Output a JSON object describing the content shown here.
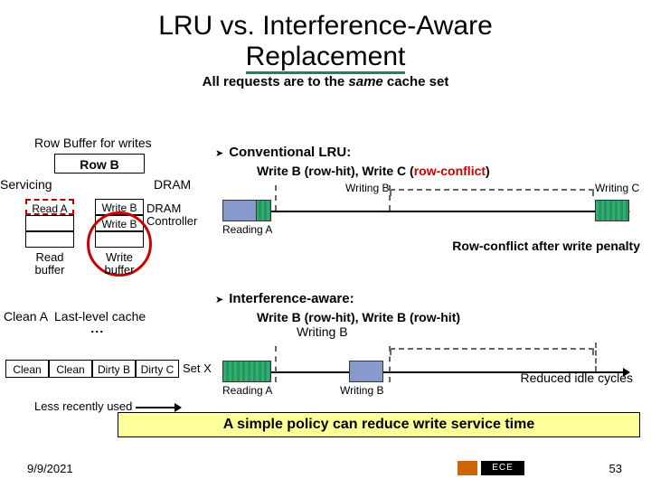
{
  "title_line1": "LRU vs. Interference-Aware",
  "title_line2": "Replacement",
  "subheader_pre": "All requests are to the ",
  "subheader_em": "same",
  "subheader_post": " cache set",
  "left": {
    "row_buffer": "Row Buffer for writes",
    "row_b": "Row B",
    "servicing": "Servicing",
    "dram": "DRAM",
    "read_a": "Read A",
    "write_b1": "Write B",
    "write_b2": "Write B",
    "dram_ctrl1": "DRAM",
    "dram_ctrl2": "Controller",
    "read_buf": "Read\nbuffer",
    "write_buf": "Write\nbuffer",
    "clean_a": "Clean A",
    "llc": "Last-level cache",
    "cells": [
      "Clean",
      "Clean",
      "Dirty B",
      "Dirty C"
    ],
    "setx": "Set X",
    "lru": "Less recently used"
  },
  "lru_section": {
    "heading": "Conventional LRU:",
    "sub": "Write B (row-hit), Write C (row-conflict)",
    "writing_b": "Writing B",
    "writing_c": "Writing C",
    "reading_a": "Reading A",
    "penalty": "Row-conflict after write penalty"
  },
  "ia_section": {
    "heading": "Interference-aware:",
    "sub": "Write B (row-hit), Write B (row-hit)",
    "writing_b": "Writing B",
    "writing_b2": "Writing B",
    "reading_a": "Reading A",
    "reduced": "Reduced idle cycles"
  },
  "conclusion": "A simple policy can reduce write service time",
  "footer": {
    "date": "9/9/2021",
    "ece": "ECE",
    "page": "53"
  }
}
